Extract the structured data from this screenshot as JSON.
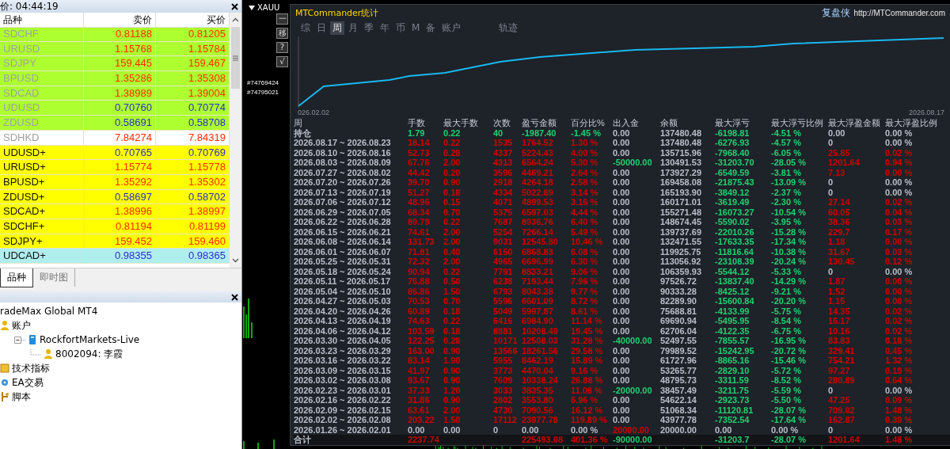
{
  "market_watch": {
    "title": "价: 04:44:19",
    "columns": [
      "品种",
      "卖价",
      "买价"
    ],
    "rows": [
      {
        "symbol": "SDCHF",
        "bid": "0.81188",
        "ask": "0.81205",
        "color": "#adff2f",
        "rising": false,
        "dimmed": true
      },
      {
        "symbol": "URUSD",
        "bid": "1.15768",
        "ask": "1.15784",
        "color": "#adff2f",
        "rising": false,
        "dimmed": true
      },
      {
        "symbol": "SDJPY",
        "bid": "159.445",
        "ask": "159.467",
        "color": "#adff2f",
        "rising": false,
        "dimmed": true
      },
      {
        "symbol": "BPUSD",
        "bid": "1.35286",
        "ask": "1.35308",
        "color": "#adff2f",
        "rising": false,
        "dimmed": true
      },
      {
        "symbol": "SDCAD",
        "bid": "1.38989",
        "ask": "1.39004",
        "color": "#adff2f",
        "rising": false,
        "dimmed": true
      },
      {
        "symbol": "UDUSD",
        "bid": "0.70760",
        "ask": "0.70774",
        "color": "#adff2f",
        "rising": true,
        "dimmed": true
      },
      {
        "symbol": "ZDUSD",
        "bid": "0.58691",
        "ask": "0.58708",
        "color": "#adff2f",
        "rising": true,
        "dimmed": true
      },
      {
        "symbol": "SDHKD",
        "bid": "7.84274",
        "ask": "7.84319",
        "color": "#ffffff",
        "rising": false,
        "dimmed": true
      },
      {
        "symbol": "UDUSD+",
        "bid": "0.70765",
        "ask": "0.70769",
        "color": "#ffff00",
        "rising": true,
        "dimmed": false
      },
      {
        "symbol": "URUSD+",
        "bid": "1.15774",
        "ask": "1.15778",
        "color": "#ffff00",
        "rising": false,
        "dimmed": false
      },
      {
        "symbol": "BPUSD+",
        "bid": "1.35292",
        "ask": "1.35302",
        "color": "#ffff00",
        "rising": false,
        "dimmed": false
      },
      {
        "symbol": "ZDUSD+",
        "bid": "0.58697",
        "ask": "0.58702",
        "color": "#ffff00",
        "rising": true,
        "dimmed": false
      },
      {
        "symbol": "SDCAD+",
        "bid": "1.38996",
        "ask": "1.38997",
        "color": "#ffff00",
        "rising": false,
        "dimmed": false
      },
      {
        "symbol": "SDCHF+",
        "bid": "0.81194",
        "ask": "0.81199",
        "color": "#ffff00",
        "rising": false,
        "dimmed": false
      },
      {
        "symbol": "SDJPY+",
        "bid": "159.452",
        "ask": "159.460",
        "color": "#ffff00",
        "rising": false,
        "dimmed": false
      },
      {
        "symbol": "UDCAD+",
        "bid": "0.98355",
        "ask": "0.98365",
        "color": "#b0eeee",
        "rising": true,
        "dimmed": false
      }
    ]
  },
  "left_tabs": [
    {
      "label": "品种",
      "selected": true
    },
    {
      "label": "即时图",
      "selected": false
    }
  ],
  "navigator": {
    "tree": [
      {
        "label": "radeMax Global MT4",
        "children": [
          {
            "label": "账户",
            "kind": "accounts",
            "children": [
              {
                "label": "RockfortMarkets-Live",
                "kind": "server",
                "expanded": true,
                "children": [
                  {
                    "label": "8002094: 李霞",
                    "kind": "account"
                  }
                ]
              }
            ]
          },
          {
            "label": "技术指标",
            "kind": "indicators"
          },
          {
            "label": "EA交易",
            "kind": "experts"
          },
          {
            "label": "脚本",
            "kind": "scripts"
          }
        ]
      }
    ]
  },
  "chart_window": {
    "symbol": "XAUU",
    "buttons": [
      "一",
      "移",
      "?",
      "√"
    ],
    "order_labels": [
      "#74769424",
      "#74795021"
    ]
  },
  "stats": {
    "title": "MTCommander统计",
    "brand": "复盘侠",
    "url": "http://MTCommander.com",
    "tabs": [
      {
        "label": "综",
        "selected": false
      },
      {
        "label": "日",
        "selected": false
      },
      {
        "label": "周",
        "selected": true
      },
      {
        "label": "月",
        "selected": false
      },
      {
        "label": "季",
        "selected": false
      },
      {
        "label": "年",
        "selected": false
      },
      {
        "label": "币",
        "selected": false
      },
      {
        "label": "M",
        "selected": false
      },
      {
        "label": "备",
        "selected": false
      },
      {
        "label": "账户",
        "selected": false
      },
      {
        "label": "轨迹",
        "selected": false
      }
    ],
    "chart": {
      "start_label": "026.02.02",
      "end_label": "2026.08.17"
    },
    "columns": [
      "周",
      "手数",
      "最大手数",
      "次数",
      "盈亏金额",
      "百分比%",
      "出入金",
      "余额",
      "最大浮亏",
      "最大浮亏比例",
      "最大浮盈金额",
      "最大浮盈比例"
    ],
    "rows": [
      {
        "cells": [
          {
            "text": "持仓",
            "color": "#b9bfc9"
          },
          {
            "text": "1.79",
            "color": "#20d070"
          },
          {
            "text": "0.22",
            "color": "#20d070"
          },
          {
            "text": "40",
            "color": "#20d070"
          },
          {
            "text": "-1987.40",
            "color": "#20d070"
          },
          {
            "text": "-1.45 %",
            "color": "#20d070"
          },
          {
            "text": "0.00",
            "color": "#b9bfc9"
          },
          {
            "text": "137480.48",
            "color": "#b9bfc9"
          },
          {
            "text": "-6198.81",
            "color": "#20d070"
          },
          {
            "text": "-4.51 %",
            "color": "#20d070"
          },
          {
            "text": "0.00",
            "color": "#b9bfc9"
          },
          {
            "text": "0.00 %",
            "color": "#b9bfc9"
          }
        ]
      },
      {
        "cells": [
          {
            "text": "2026.08.17 ~ 2026.08.23",
            "color": "#b9bfc9"
          },
          {
            "text": "18.14",
            "color": "#d00000"
          },
          {
            "text": "0.22",
            "color": "#d00000"
          },
          {
            "text": "1535",
            "color": "#d00000"
          },
          {
            "text": "1764.52",
            "color": "#d00000"
          },
          {
            "text": "1.30 %",
            "color": "#d00000"
          },
          {
            "text": "0.00",
            "color": "#b9bfc9"
          },
          {
            "text": "137480.48",
            "color": "#b9bfc9"
          },
          {
            "text": "-6276.93",
            "color": "#20d070"
          },
          {
            "text": "-4.57 %",
            "color": "#20d070"
          },
          {
            "text": "0",
            "color": "#b9bfc9"
          },
          {
            "text": "0.00 %",
            "color": "#b9bfc9"
          }
        ]
      },
      {
        "cells": [
          {
            "text": "2026.08.10 ~ 2026.08.16",
            "color": "#b9bfc9"
          },
          {
            "text": "52.73",
            "color": "#d00000"
          },
          {
            "text": "0.28",
            "color": "#d00000"
          },
          {
            "text": "4337",
            "color": "#d00000"
          },
          {
            "text": "5224.43",
            "color": "#d00000"
          },
          {
            "text": "4.00 %",
            "color": "#d00000"
          },
          {
            "text": "0.00",
            "color": "#b9bfc9"
          },
          {
            "text": "135715.96",
            "color": "#b9bfc9"
          },
          {
            "text": "-7968.40",
            "color": "#20d070"
          },
          {
            "text": "-6.05 %",
            "color": "#20d070"
          },
          {
            "text": "25.85",
            "color": "#d00000"
          },
          {
            "text": "0.02 %",
            "color": "#d00000"
          }
        ]
      },
      {
        "cells": [
          {
            "text": "2026.08.03 ~ 2026.08.09",
            "color": "#b9bfc9"
          },
          {
            "text": "67.76",
            "color": "#d00000"
          },
          {
            "text": "2.00",
            "color": "#d00000"
          },
          {
            "text": "4313",
            "color": "#d00000"
          },
          {
            "text": "6564.24",
            "color": "#d00000"
          },
          {
            "text": "5.30 %",
            "color": "#d00000"
          },
          {
            "text": "-50000.00",
            "color": "#20d070"
          },
          {
            "text": "130491.53",
            "color": "#b9bfc9"
          },
          {
            "text": "-31203.70",
            "color": "#20d070"
          },
          {
            "text": "-28.05 %",
            "color": "#20d070"
          },
          {
            "text": "1201.64",
            "color": "#d00000"
          },
          {
            "text": "0.94 %",
            "color": "#d00000"
          }
        ]
      },
      {
        "cells": [
          {
            "text": "2026.07.27 ~ 2026.08.02",
            "color": "#b9bfc9"
          },
          {
            "text": "44.42",
            "color": "#d00000"
          },
          {
            "text": "0.20",
            "color": "#d00000"
          },
          {
            "text": "3596",
            "color": "#d00000"
          },
          {
            "text": "4469.21",
            "color": "#d00000"
          },
          {
            "text": "2.64 %",
            "color": "#d00000"
          },
          {
            "text": "0.00",
            "color": "#b9bfc9"
          },
          {
            "text": "173927.29",
            "color": "#b9bfc9"
          },
          {
            "text": "-6549.59",
            "color": "#20d070"
          },
          {
            "text": "-3.81 %",
            "color": "#20d070"
          },
          {
            "text": "7.13",
            "color": "#d00000"
          },
          {
            "text": "0.00 %",
            "color": "#d00000"
          }
        ]
      },
      {
        "cells": [
          {
            "text": "2026.07.20 ~ 2026.07.26",
            "color": "#b9bfc9"
          },
          {
            "text": "39.70",
            "color": "#d00000"
          },
          {
            "text": "0.90",
            "color": "#d00000"
          },
          {
            "text": "2918",
            "color": "#d00000"
          },
          {
            "text": "4264.18",
            "color": "#d00000"
          },
          {
            "text": "2.58 %",
            "color": "#d00000"
          },
          {
            "text": "0.00",
            "color": "#b9bfc9"
          },
          {
            "text": "169458.08",
            "color": "#b9bfc9"
          },
          {
            "text": "-21875.43",
            "color": "#20d070"
          },
          {
            "text": "-13.09 %",
            "color": "#20d070"
          },
          {
            "text": "0",
            "color": "#b9bfc9"
          },
          {
            "text": "0.00 %",
            "color": "#b9bfc9"
          }
        ]
      },
      {
        "cells": [
          {
            "text": "2026.07.13 ~ 2026.07.19",
            "color": "#b9bfc9"
          },
          {
            "text": "51.27",
            "color": "#d00000"
          },
          {
            "text": "0.18",
            "color": "#d00000"
          },
          {
            "text": "4334",
            "color": "#d00000"
          },
          {
            "text": "5022.89",
            "color": "#d00000"
          },
          {
            "text": "3.14 %",
            "color": "#d00000"
          },
          {
            "text": "0.00",
            "color": "#b9bfc9"
          },
          {
            "text": "165193.90",
            "color": "#b9bfc9"
          },
          {
            "text": "-3849.12",
            "color": "#20d070"
          },
          {
            "text": "-2.37 %",
            "color": "#20d070"
          },
          {
            "text": "0",
            "color": "#b9bfc9"
          },
          {
            "text": "0.00 %",
            "color": "#b9bfc9"
          }
        ]
      },
      {
        "cells": [
          {
            "text": "2026.07.06 ~ 2026.07.12",
            "color": "#b9bfc9"
          },
          {
            "text": "48.96",
            "color": "#d00000"
          },
          {
            "text": "0.15",
            "color": "#d00000"
          },
          {
            "text": "4071",
            "color": "#d00000"
          },
          {
            "text": "4899.53",
            "color": "#d00000"
          },
          {
            "text": "3.16 %",
            "color": "#d00000"
          },
          {
            "text": "0.00",
            "color": "#b9bfc9"
          },
          {
            "text": "160171.01",
            "color": "#b9bfc9"
          },
          {
            "text": "-3619.49",
            "color": "#20d070"
          },
          {
            "text": "-2.30 %",
            "color": "#20d070"
          },
          {
            "text": "27.14",
            "color": "#d00000"
          },
          {
            "text": "0.02 %",
            "color": "#d00000"
          }
        ]
      },
      {
        "cells": [
          {
            "text": "2026.06.29 ~ 2026.07.05",
            "color": "#b9bfc9"
          },
          {
            "text": "68.34",
            "color": "#d00000"
          },
          {
            "text": "0.70",
            "color": "#d00000"
          },
          {
            "text": "5375",
            "color": "#d00000"
          },
          {
            "text": "6597.03",
            "color": "#d00000"
          },
          {
            "text": "4.44 %",
            "color": "#d00000"
          },
          {
            "text": "0.00",
            "color": "#b9bfc9"
          },
          {
            "text": "155271.48",
            "color": "#b9bfc9"
          },
          {
            "text": "-16073.27",
            "color": "#20d070"
          },
          {
            "text": "-10.54 %",
            "color": "#20d070"
          },
          {
            "text": "60.05",
            "color": "#d00000"
          },
          {
            "text": "0.04 %",
            "color": "#d00000"
          }
        ]
      },
      {
        "cells": [
          {
            "text": "2026.06.22 ~ 2026.06.28",
            "color": "#b9bfc9"
          },
          {
            "text": "89.79",
            "color": "#d00000"
          },
          {
            "text": "0.22",
            "color": "#d00000"
          },
          {
            "text": "7687",
            "color": "#d00000"
          },
          {
            "text": "8936.76",
            "color": "#d00000"
          },
          {
            "text": "6.40 %",
            "color": "#d00000"
          },
          {
            "text": "0.00",
            "color": "#b9bfc9"
          },
          {
            "text": "148674.45",
            "color": "#b9bfc9"
          },
          {
            "text": "-5590.02",
            "color": "#20d070"
          },
          {
            "text": "-3.95 %",
            "color": "#20d070"
          },
          {
            "text": "38.36",
            "color": "#d00000"
          },
          {
            "text": "0.03 %",
            "color": "#d00000"
          }
        ]
      },
      {
        "cells": [
          {
            "text": "2026.06.15 ~ 2026.06.21",
            "color": "#b9bfc9"
          },
          {
            "text": "74.61",
            "color": "#d00000"
          },
          {
            "text": "2.00",
            "color": "#d00000"
          },
          {
            "text": "5254",
            "color": "#d00000"
          },
          {
            "text": "7266.14",
            "color": "#d00000"
          },
          {
            "text": "5.49 %",
            "color": "#d00000"
          },
          {
            "text": "0.00",
            "color": "#b9bfc9"
          },
          {
            "text": "139737.69",
            "color": "#b9bfc9"
          },
          {
            "text": "-22010.26",
            "color": "#20d070"
          },
          {
            "text": "-15.28 %",
            "color": "#20d070"
          },
          {
            "text": "229.7",
            "color": "#d00000"
          },
          {
            "text": "0.17 %",
            "color": "#d00000"
          }
        ]
      },
      {
        "cells": [
          {
            "text": "2026.06.08 ~ 2026.06.14",
            "color": "#b9bfc9"
          },
          {
            "text": "131.73",
            "color": "#d00000"
          },
          {
            "text": "2.00",
            "color": "#d00000"
          },
          {
            "text": "9031",
            "color": "#d00000"
          },
          {
            "text": "12545.80",
            "color": "#d00000"
          },
          {
            "text": "10.46 %",
            "color": "#d00000"
          },
          {
            "text": "0.00",
            "color": "#b9bfc9"
          },
          {
            "text": "132471.55",
            "color": "#b9bfc9"
          },
          {
            "text": "-17633.35",
            "color": "#20d070"
          },
          {
            "text": "-17.34 %",
            "color": "#20d070"
          },
          {
            "text": "1.18",
            "color": "#d00000"
          },
          {
            "text": "0.00 %",
            "color": "#d00000"
          }
        ]
      },
      {
        "cells": [
          {
            "text": "2026.06.01 ~ 2026.06.07",
            "color": "#b9bfc9"
          },
          {
            "text": "71.81",
            "color": "#d00000"
          },
          {
            "text": "0.40",
            "color": "#d00000"
          },
          {
            "text": "6150",
            "color": "#d00000"
          },
          {
            "text": "6868.83",
            "color": "#d00000"
          },
          {
            "text": "6.08 %",
            "color": "#d00000"
          },
          {
            "text": "0.00",
            "color": "#b9bfc9"
          },
          {
            "text": "119925.75",
            "color": "#b9bfc9"
          },
          {
            "text": "-11816.64",
            "color": "#20d070"
          },
          {
            "text": "-10.38 %",
            "color": "#20d070"
          },
          {
            "text": "31.67",
            "color": "#d00000"
          },
          {
            "text": "0.03 %",
            "color": "#d00000"
          }
        ]
      },
      {
        "cells": [
          {
            "text": "2026.05.25 ~ 2026.05.31",
            "color": "#b9bfc9"
          },
          {
            "text": "72.32",
            "color": "#d00000"
          },
          {
            "text": "2.00",
            "color": "#d00000"
          },
          {
            "text": "4965",
            "color": "#d00000"
          },
          {
            "text": "6696.99",
            "color": "#d00000"
          },
          {
            "text": "6.30 %",
            "color": "#d00000"
          },
          {
            "text": "0.00",
            "color": "#b9bfc9"
          },
          {
            "text": "113056.92",
            "color": "#b9bfc9"
          },
          {
            "text": "-23108.39",
            "color": "#20d070"
          },
          {
            "text": "-20.24 %",
            "color": "#20d070"
          },
          {
            "text": "130.45",
            "color": "#d00000"
          },
          {
            "text": "0.12 %",
            "color": "#d00000"
          }
        ]
      },
      {
        "cells": [
          {
            "text": "2026.05.18 ~ 2026.05.24",
            "color": "#b9bfc9"
          },
          {
            "text": "90.94",
            "color": "#d00000"
          },
          {
            "text": "0.22",
            "color": "#d00000"
          },
          {
            "text": "7791",
            "color": "#d00000"
          },
          {
            "text": "8833.21",
            "color": "#d00000"
          },
          {
            "text": "9.06 %",
            "color": "#d00000"
          },
          {
            "text": "0.00",
            "color": "#b9bfc9"
          },
          {
            "text": "106359.93",
            "color": "#b9bfc9"
          },
          {
            "text": "-5544.12",
            "color": "#20d070"
          },
          {
            "text": "-5.33 %",
            "color": "#20d070"
          },
          {
            "text": "0",
            "color": "#b9bfc9"
          },
          {
            "text": "0.00 %",
            "color": "#b9bfc9"
          }
        ]
      },
      {
        "cells": [
          {
            "text": "2026.05.11 ~ 2026.05.17",
            "color": "#b9bfc9"
          },
          {
            "text": "76.88",
            "color": "#d00000"
          },
          {
            "text": "0.50",
            "color": "#d00000"
          },
          {
            "text": "6238",
            "color": "#d00000"
          },
          {
            "text": "7193.44",
            "color": "#d00000"
          },
          {
            "text": "7.96 %",
            "color": "#d00000"
          },
          {
            "text": "0.00",
            "color": "#b9bfc9"
          },
          {
            "text": "97526.72",
            "color": "#b9bfc9"
          },
          {
            "text": "-13837.40",
            "color": "#20d070"
          },
          {
            "text": "-14.29 %",
            "color": "#20d070"
          },
          {
            "text": "1.87",
            "color": "#d00000"
          },
          {
            "text": "0.00 %",
            "color": "#d00000"
          }
        ]
      },
      {
        "cells": [
          {
            "text": "2026.05.04 ~ 2026.05.10",
            "color": "#b9bfc9"
          },
          {
            "text": "86.86",
            "color": "#d00000"
          },
          {
            "text": "1.50",
            "color": "#d00000"
          },
          {
            "text": "6793",
            "color": "#d00000"
          },
          {
            "text": "8043.38",
            "color": "#d00000"
          },
          {
            "text": "9.77 %",
            "color": "#d00000"
          },
          {
            "text": "0.00",
            "color": "#b9bfc9"
          },
          {
            "text": "90333.28",
            "color": "#b9bfc9"
          },
          {
            "text": "-8425.12",
            "color": "#20d070"
          },
          {
            "text": "-9.21 %",
            "color": "#20d070"
          },
          {
            "text": "1.52",
            "color": "#d00000"
          },
          {
            "text": "0.00 %",
            "color": "#d00000"
          }
        ]
      },
      {
        "cells": [
          {
            "text": "2026.04.27 ~ 2026.05.03",
            "color": "#b9bfc9"
          },
          {
            "text": "70.53",
            "color": "#d00000"
          },
          {
            "text": "0.70",
            "color": "#d00000"
          },
          {
            "text": "5596",
            "color": "#d00000"
          },
          {
            "text": "6601.09",
            "color": "#d00000"
          },
          {
            "text": "8.72 %",
            "color": "#d00000"
          },
          {
            "text": "0.00",
            "color": "#b9bfc9"
          },
          {
            "text": "82289.90",
            "color": "#b9bfc9"
          },
          {
            "text": "-15600.84",
            "color": "#20d070"
          },
          {
            "text": "-20.20 %",
            "color": "#20d070"
          },
          {
            "text": "1.15",
            "color": "#d00000"
          },
          {
            "text": "0.00 %",
            "color": "#d00000"
          }
        ]
      },
      {
        "cells": [
          {
            "text": "2026.04.20 ~ 2026.04.26",
            "color": "#b9bfc9"
          },
          {
            "text": "60.89",
            "color": "#d00000"
          },
          {
            "text": "0.18",
            "color": "#d00000"
          },
          {
            "text": "5049",
            "color": "#d00000"
          },
          {
            "text": "5997.87",
            "color": "#d00000"
          },
          {
            "text": "8.61 %",
            "color": "#d00000"
          },
          {
            "text": "0.00",
            "color": "#b9bfc9"
          },
          {
            "text": "75688.81",
            "color": "#b9bfc9"
          },
          {
            "text": "-4133.99",
            "color": "#20d070"
          },
          {
            "text": "-5.75 %",
            "color": "#20d070"
          },
          {
            "text": "14.35",
            "color": "#d00000"
          },
          {
            "text": "0.02 %",
            "color": "#d00000"
          }
        ]
      },
      {
        "cells": [
          {
            "text": "2026.04.13 ~ 2026.04.19",
            "color": "#b9bfc9"
          },
          {
            "text": "74.63",
            "color": "#d00000"
          },
          {
            "text": "0.22",
            "color": "#d00000"
          },
          {
            "text": "6416",
            "color": "#d00000"
          },
          {
            "text": "6984.90",
            "color": "#d00000"
          },
          {
            "text": "11.14 %",
            "color": "#d00000"
          },
          {
            "text": "0.00",
            "color": "#b9bfc9"
          },
          {
            "text": "69690.94",
            "color": "#b9bfc9"
          },
          {
            "text": "-5495.95",
            "color": "#20d070"
          },
          {
            "text": "-8.54 %",
            "color": "#20d070"
          },
          {
            "text": "16.17",
            "color": "#d00000"
          },
          {
            "text": "0.02 %",
            "color": "#d00000"
          }
        ]
      },
      {
        "cells": [
          {
            "text": "2026.04.06 ~ 2026.04.12",
            "color": "#b9bfc9"
          },
          {
            "text": "103.59",
            "color": "#d00000"
          },
          {
            "text": "0.18",
            "color": "#d00000"
          },
          {
            "text": "8881",
            "color": "#d00000"
          },
          {
            "text": "10208.49",
            "color": "#d00000"
          },
          {
            "text": "19.45 %",
            "color": "#d00000"
          },
          {
            "text": "0.00",
            "color": "#b9bfc9"
          },
          {
            "text": "62706.04",
            "color": "#b9bfc9"
          },
          {
            "text": "-4122.35",
            "color": "#20d070"
          },
          {
            "text": "-6.75 %",
            "color": "#20d070"
          },
          {
            "text": "10.16",
            "color": "#d00000"
          },
          {
            "text": "0.02 %",
            "color": "#d00000"
          }
        ]
      },
      {
        "cells": [
          {
            "text": "2026.03.30 ~ 2026.04.05",
            "color": "#b9bfc9"
          },
          {
            "text": "122.25",
            "color": "#d00000"
          },
          {
            "text": "0.28",
            "color": "#d00000"
          },
          {
            "text": "10171",
            "color": "#d00000"
          },
          {
            "text": "12508.03",
            "color": "#d00000"
          },
          {
            "text": "31.28 %",
            "color": "#d00000"
          },
          {
            "text": "-40000.00",
            "color": "#20d070"
          },
          {
            "text": "52497.55",
            "color": "#b9bfc9"
          },
          {
            "text": "-7855.57",
            "color": "#20d070"
          },
          {
            "text": "-16.95 %",
            "color": "#20d070"
          },
          {
            "text": "83.83",
            "color": "#d00000"
          },
          {
            "text": "0.18 %",
            "color": "#d00000"
          }
        ]
      },
      {
        "cells": [
          {
            "text": "2026.03.23 ~ 2026.03.29",
            "color": "#b9bfc9"
          },
          {
            "text": "163.00",
            "color": "#d00000"
          },
          {
            "text": "0.90",
            "color": "#d00000"
          },
          {
            "text": "13566",
            "color": "#d00000"
          },
          {
            "text": "18261.56",
            "color": "#d00000"
          },
          {
            "text": "29.58 %",
            "color": "#d00000"
          },
          {
            "text": "0.00",
            "color": "#b9bfc9"
          },
          {
            "text": "79989.52",
            "color": "#b9bfc9"
          },
          {
            "text": "-15242.95",
            "color": "#20d070"
          },
          {
            "text": "-20.72 %",
            "color": "#20d070"
          },
          {
            "text": "329.41",
            "color": "#d00000"
          },
          {
            "text": "0.45 %",
            "color": "#d00000"
          }
        ]
      },
      {
        "cells": [
          {
            "text": "2026.03.16 ~ 2026.03.22",
            "color": "#b9bfc9"
          },
          {
            "text": "83.14",
            "color": "#d00000"
          },
          {
            "text": "1.90",
            "color": "#d00000"
          },
          {
            "text": "5955",
            "color": "#d00000"
          },
          {
            "text": "8462.19",
            "color": "#d00000"
          },
          {
            "text": "15.89 %",
            "color": "#d00000"
          },
          {
            "text": "0.00",
            "color": "#b9bfc9"
          },
          {
            "text": "61727.96",
            "color": "#b9bfc9"
          },
          {
            "text": "-8865.16",
            "color": "#20d070"
          },
          {
            "text": "-15.46 %",
            "color": "#20d070"
          },
          {
            "text": "754.21",
            "color": "#d00000"
          },
          {
            "text": "1.32 %",
            "color": "#d00000"
          }
        ]
      },
      {
        "cells": [
          {
            "text": "2026.03.09 ~ 2026.03.15",
            "color": "#b9bfc9"
          },
          {
            "text": "41.97",
            "color": "#d00000"
          },
          {
            "text": "0.90",
            "color": "#d00000"
          },
          {
            "text": "3773",
            "color": "#d00000"
          },
          {
            "text": "4470.04",
            "color": "#d00000"
          },
          {
            "text": "9.16 %",
            "color": "#d00000"
          },
          {
            "text": "0.00",
            "color": "#b9bfc9"
          },
          {
            "text": "53265.77",
            "color": "#b9bfc9"
          },
          {
            "text": "-2829.10",
            "color": "#20d070"
          },
          {
            "text": "-5.72 %",
            "color": "#20d070"
          },
          {
            "text": "97.27",
            "color": "#d00000"
          },
          {
            "text": "0.19 %",
            "color": "#d00000"
          }
        ]
      },
      {
        "cells": [
          {
            "text": "2026.03.02 ~ 2026.03.08",
            "color": "#b9bfc9"
          },
          {
            "text": "93.67",
            "color": "#d00000"
          },
          {
            "text": "0.90",
            "color": "#d00000"
          },
          {
            "text": "7609",
            "color": "#d00000"
          },
          {
            "text": "10338.24",
            "color": "#d00000"
          },
          {
            "text": "26.88 %",
            "color": "#d00000"
          },
          {
            "text": "0.00",
            "color": "#b9bfc9"
          },
          {
            "text": "48795.73",
            "color": "#b9bfc9"
          },
          {
            "text": "-3311.59",
            "color": "#20d070"
          },
          {
            "text": "-8.52 %",
            "color": "#20d070"
          },
          {
            "text": "280.89",
            "color": "#d00000"
          },
          {
            "text": "0.64 %",
            "color": "#d00000"
          }
        ]
      },
      {
        "cells": [
          {
            "text": "2026.02.23 ~ 2026.03.01",
            "color": "#b9bfc9"
          },
          {
            "text": "37.33",
            "color": "#d00000"
          },
          {
            "text": "1.20",
            "color": "#d00000"
          },
          {
            "text": "3033",
            "color": "#d00000"
          },
          {
            "text": "3835.35",
            "color": "#d00000"
          },
          {
            "text": "11.08 %",
            "color": "#d00000"
          },
          {
            "text": "-20000.00",
            "color": "#20d070"
          },
          {
            "text": "38457.49",
            "color": "#b9bfc9"
          },
          {
            "text": "-3211.75",
            "color": "#20d070"
          },
          {
            "text": "-5.59 %",
            "color": "#20d070"
          },
          {
            "text": "0",
            "color": "#b9bfc9"
          },
          {
            "text": "0.00 %",
            "color": "#b9bfc9"
          }
        ]
      },
      {
        "cells": [
          {
            "text": "2026.02.16 ~ 2026.02.22",
            "color": "#b9bfc9"
          },
          {
            "text": "31.86",
            "color": "#d00000"
          },
          {
            "text": "0.90",
            "color": "#d00000"
          },
          {
            "text": "2802",
            "color": "#d00000"
          },
          {
            "text": "3553.80",
            "color": "#d00000"
          },
          {
            "text": "6.96 %",
            "color": "#d00000"
          },
          {
            "text": "0.00",
            "color": "#b9bfc9"
          },
          {
            "text": "54622.14",
            "color": "#b9bfc9"
          },
          {
            "text": "-2923.73",
            "color": "#20d070"
          },
          {
            "text": "-5.50 %",
            "color": "#20d070"
          },
          {
            "text": "47.25",
            "color": "#d00000"
          },
          {
            "text": "0.09 %",
            "color": "#d00000"
          }
        ]
      },
      {
        "cells": [
          {
            "text": "2026.02.09 ~ 2026.02.15",
            "color": "#b9bfc9"
          },
          {
            "text": "63.61",
            "color": "#d00000"
          },
          {
            "text": "2.00",
            "color": "#d00000"
          },
          {
            "text": "4730",
            "color": "#d00000"
          },
          {
            "text": "7090.56",
            "color": "#d00000"
          },
          {
            "text": "16.12 %",
            "color": "#d00000"
          },
          {
            "text": "0.00",
            "color": "#b9bfc9"
          },
          {
            "text": "51068.34",
            "color": "#b9bfc9"
          },
          {
            "text": "-11120.81",
            "color": "#20d070"
          },
          {
            "text": "-28.07 %",
            "color": "#20d070"
          },
          {
            "text": "709.02",
            "color": "#d00000"
          },
          {
            "text": "1.48 %",
            "color": "#d00000"
          }
        ]
      },
      {
        "cells": [
          {
            "text": "2026.02.02 ~ 2026.02.08",
            "color": "#b9bfc9"
          },
          {
            "text": "203.22",
            "color": "#d00000"
          },
          {
            "text": "1.50",
            "color": "#d00000"
          },
          {
            "text": "17112",
            "color": "#d00000"
          },
          {
            "text": "23977.78",
            "color": "#d00000"
          },
          {
            "text": "119.89 %",
            "color": "#d00000"
          },
          {
            "text": "0.00",
            "color": "#b9bfc9"
          },
          {
            "text": "43977.78",
            "color": "#b9bfc9"
          },
          {
            "text": "-7352.54",
            "color": "#20d070"
          },
          {
            "text": "-17.64 %",
            "color": "#20d070"
          },
          {
            "text": "162.87",
            "color": "#d00000"
          },
          {
            "text": "0.39 %",
            "color": "#d00000"
          }
        ]
      },
      {
        "cells": [
          {
            "text": "2026.01.26 ~ 2026.02.01",
            "color": "#b9bfc9"
          },
          {
            "text": "0.00",
            "color": "#b9bfc9"
          },
          {
            "text": "0.00",
            "color": "#b9bfc9"
          },
          {
            "text": "0",
            "color": "#b9bfc9"
          },
          {
            "text": "0.00",
            "color": "#b9bfc9"
          },
          {
            "text": "0.00 %",
            "color": "#b9bfc9"
          },
          {
            "text": "20000.00",
            "color": "#d00000"
          },
          {
            "text": "20000.00",
            "color": "#b9bfc9"
          },
          {
            "text": "0.00",
            "color": "#b9bfc9"
          },
          {
            "text": "0.00 %",
            "color": "#b9bfc9"
          },
          {
            "text": "0",
            "color": "#b9bfc9"
          },
          {
            "text": "0.00 %",
            "color": "#b9bfc9"
          }
        ]
      }
    ],
    "total": {
      "label": "合计",
      "lots": {
        "text": "2237.74",
        "color": "#d00000"
      },
      "profit": {
        "text": "225493.08",
        "color": "#d00000"
      },
      "percent": {
        "text": "401.36 %",
        "color": "#d00000"
      },
      "deposit": {
        "text": "-90000.00",
        "color": "#20d070"
      },
      "max_loss": {
        "text": "-31203.7",
        "color": "#20d070"
      },
      "max_loss_pct": {
        "text": "-28.07 %",
        "color": "#20d070"
      },
      "max_gain": {
        "text": "1201.64",
        "color": "#d00000"
      },
      "max_gain_pct": {
        "text": "1.48 %",
        "color": "#d00000"
      }
    }
  }
}
